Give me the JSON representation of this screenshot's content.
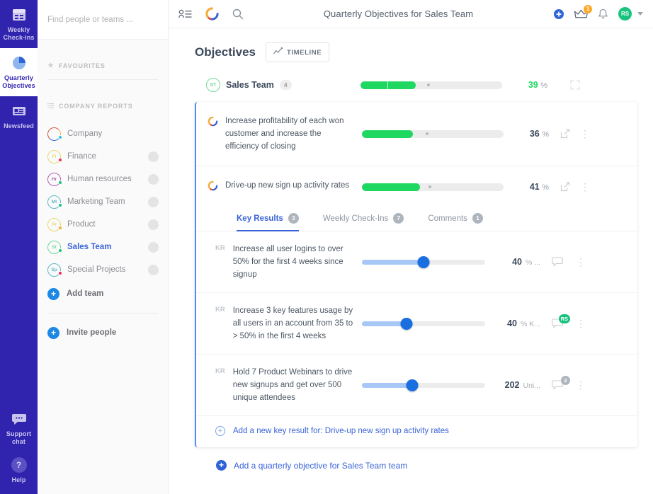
{
  "rail": {
    "items": [
      {
        "id": "weekly-check-ins",
        "label": "Weekly\nCheck-ins",
        "icon": "calendar-icon",
        "active": false
      },
      {
        "id": "quarterly-objectives",
        "label": "Quarterly\nObjectives",
        "icon": "pie-chart-icon",
        "active": true
      },
      {
        "id": "newsfeed",
        "label": "Newsfeed",
        "icon": "newsfeed-icon",
        "active": false
      }
    ],
    "bottom": [
      {
        "id": "support-chat",
        "label": "Support\nchat",
        "icon": "chat-bubble-icon"
      },
      {
        "id": "help",
        "label": "Help",
        "icon": "question-mark-icon"
      }
    ],
    "bg_color": "#3023ae"
  },
  "panel": {
    "search": {
      "placeholder": "Find people or teams ...",
      "value": ""
    },
    "favourites": {
      "label": "FAVOURITES",
      "icon": "star-icon"
    },
    "company_reports": {
      "label": "COMPANY REPORTS",
      "icon": "list-icon"
    },
    "teams": [
      {
        "initials": "",
        "label": "Company",
        "dot_color": "#28c8e8",
        "ring_color": "#c9553f",
        "selected": false,
        "has_toggle": false
      },
      {
        "initials": "Fi",
        "label": "Finance",
        "dot_color": "#ef2d56",
        "ring_color": "#e8d86a",
        "selected": false,
        "has_toggle": true
      },
      {
        "initials": "Hr",
        "label": "Human resources",
        "dot_color": "#19c37d",
        "ring_color": "#b35fb0",
        "selected": false,
        "has_toggle": true
      },
      {
        "initials": "Mt",
        "label": "Marketing Team",
        "dot_color": "#19c37d",
        "ring_color": "#5fb6c9",
        "selected": false,
        "has_toggle": true
      },
      {
        "initials": "Pr",
        "label": "Product",
        "dot_color": "#f2b134",
        "ring_color": "#e8d86a",
        "selected": false,
        "has_toggle": true
      },
      {
        "initials": "St",
        "label": "Sales Team",
        "dot_color": "#19c37d",
        "ring_color": "#6fd99a",
        "selected": true,
        "has_toggle": true
      },
      {
        "initials": "Sp",
        "label": "Special Projects",
        "dot_color": "#ef2d56",
        "ring_color": "#5fb6c9",
        "selected": false,
        "has_toggle": true
      }
    ],
    "add_team_label": "Add team",
    "invite_people_label": "Invite people"
  },
  "topbar": {
    "people_icon": "people-list-icon",
    "logo_icon": "app-logo-icon",
    "search_icon": "search-icon",
    "title": "Quarterly Objectives for Sales Team",
    "add_icon": "add-circle-icon",
    "upgrade_icon": "crown-icon",
    "upgrade_badge": "1",
    "bell_icon": "bell-icon",
    "avatar_initials": "RS"
  },
  "page": {
    "title": "Objectives",
    "timeline_button": {
      "label": "TIMELINE",
      "icon": "timeline-chart-icon"
    }
  },
  "team_summary": {
    "initials": "ST",
    "name": "Sales Team",
    "count": "4",
    "percent": "39",
    "percent_unit": "%",
    "progress_fill": 39,
    "progress_marker": 48,
    "seam_at": 19,
    "collapse_icon": "collapse-icon"
  },
  "objectives": [
    {
      "icon": "objective-ring-icon",
      "text": "Increase profitability of each won customer and increase the efficiency of closing",
      "percent": "36",
      "percent_unit": "%",
      "progress_fill": 36,
      "progress_marker": 46,
      "expand_icon": "open-external-icon",
      "menu_icon": "kebab-menu-icon",
      "expanded": false
    },
    {
      "icon": "objective-ring-icon",
      "text": "Drive-up new sign up activity rates",
      "percent": "41",
      "percent_unit": "%",
      "progress_fill": 41,
      "progress_marker": 48,
      "expand_icon": "open-external-icon",
      "menu_icon": "kebab-menu-icon",
      "expanded": true
    }
  ],
  "tabs": [
    {
      "label": "Key Results",
      "count": "3",
      "active": true
    },
    {
      "label": "Weekly Check-Ins",
      "count": "7",
      "active": false
    },
    {
      "label": "Comments",
      "count": "1",
      "active": false
    }
  ],
  "key_results": [
    {
      "tag": "KR",
      "text": "Increase all user logins to over 50% for the first 4 weeks since signup",
      "slider_value": 50,
      "value": "40",
      "unit": "% ...",
      "comment_icon": "comment-bubble-icon",
      "comment_badge": "",
      "comment_badge_color": "",
      "menu_icon": "kebab-menu-icon"
    },
    {
      "tag": "KR",
      "text": "Increase 3 key features usage by all users in an account from 35 to > 50% in the first 4 weeks",
      "slider_value": 36,
      "value": "40",
      "unit": "% K...",
      "comment_icon": "comment-bubble-icon",
      "comment_badge": "RS",
      "comment_badge_color": "green",
      "menu_icon": "kebab-menu-icon"
    },
    {
      "tag": "KR",
      "text": "Hold 7 Product Webinars to drive new signups and get over 500 unique attendees",
      "slider_value": 41,
      "value": "202",
      "unit": "Uni...",
      "comment_icon": "comment-bubble-icon",
      "comment_badge": "2",
      "comment_badge_color": "grey",
      "menu_icon": "kebab-menu-icon"
    }
  ],
  "add_key_result_label": "Add a new key result for: Drive-up new sign up activity rates",
  "add_objective_label": "Add a quarterly objective for Sales Team team",
  "colors": {
    "rail": "#3023ae",
    "accent_blue": "#3a63d8",
    "progress_green": "#1fd862",
    "slider_blue": "#1a6fe0"
  }
}
